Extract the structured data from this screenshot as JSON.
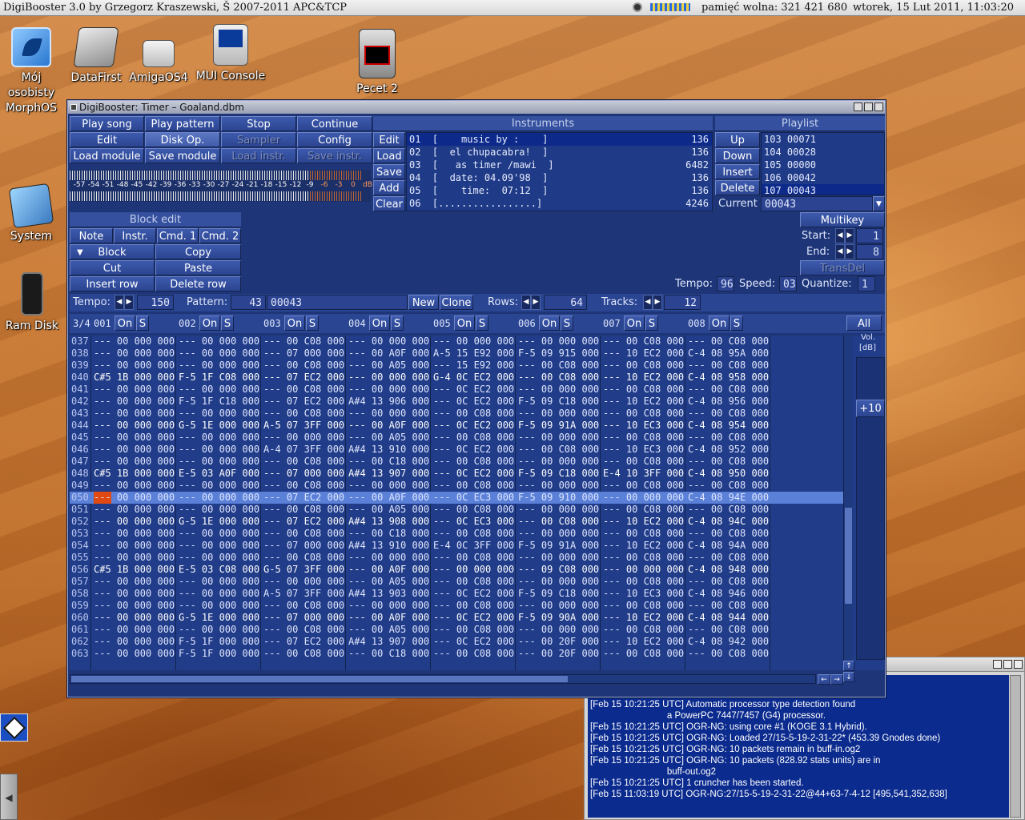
{
  "menubar": {
    "app_title": "DigiBooster 3.0 by Grzegorz Kraszewski, Š 2007-2011 APC&TCP",
    "memory": "pamięć wolna: 321 421 680",
    "clock": "wtorek, 15 Lut 2011, 11:03:20"
  },
  "desktop_icons": [
    {
      "label1": "Mój",
      "label2": "osobisty",
      "label3": "MorphOS",
      "icon": "butterfly-icon"
    },
    {
      "label1": "DataFirst",
      "icon": "harddisk-icon"
    },
    {
      "label1": "AmigaOS4",
      "icon": "amiga-boingball-icon"
    },
    {
      "label1": "MUI Console",
      "icon": "console-monitor-icon"
    },
    {
      "label1": "Pecet 2",
      "icon": "network-computer-icon"
    },
    {
      "label1": "System",
      "icon": "system-disk-icon"
    },
    {
      "label1": "Ram Disk",
      "icon": "ram-chip-icon"
    }
  ],
  "window": {
    "title": "DigiBooster: Timer – Goaland.dbm"
  },
  "transport": {
    "play_song": "Play song",
    "play_pattern": "Play pattern",
    "stop": "Stop",
    "continue": "Continue",
    "edit": "Edit",
    "disk_op": "Disk Op.",
    "sampler": "Sampler",
    "config": "Config",
    "load_module": "Load module",
    "save_module": "Save module",
    "load_instr": "Load instr.",
    "save_instr": "Save instr."
  },
  "vu_scale": [
    "-57",
    "-54",
    "-51",
    "-48",
    "-45",
    "-42",
    "-39",
    "-36",
    "-33",
    "-30",
    "-27",
    "-24",
    "-21",
    "-18",
    "-15",
    "-12",
    "-9",
    "-6",
    "-3",
    "0",
    "dB"
  ],
  "instruments": {
    "header": "Instruments",
    "buttons": {
      "edit": "Edit",
      "load": "Load",
      "save": "Save",
      "add": "Add",
      "clear": "Clear"
    },
    "rows": [
      {
        "text": "01  [    music by :    ]",
        "size": "136"
      },
      {
        "text": "02  [  el chupacabra!  ]",
        "size": "136"
      },
      {
        "text": "03  [   as timer /mawi  ]",
        "size": "6482"
      },
      {
        "text": "04  [  date: 04.09'98  ]",
        "size": "136"
      },
      {
        "text": "05  [    time:  07:12  ]",
        "size": "136"
      },
      {
        "text": "06  [.................]",
        "size": "4246"
      }
    ]
  },
  "playlist": {
    "header": "Playlist",
    "buttons": {
      "up": "Up",
      "down": "Down",
      "insert": "Insert",
      "delete": "Delete"
    },
    "rows": [
      "103 00071",
      "104 00028",
      "105 00000",
      "106 00042",
      "107 00043"
    ],
    "current_label": "Current",
    "current_value": "00043"
  },
  "block_edit": {
    "header": "Block edit",
    "note": "Note",
    "instr": "Instr.",
    "cmd1": "Cmd. 1",
    "cmd2": "Cmd. 2",
    "block": "Block",
    "copy": "Copy",
    "cut": "Cut",
    "paste": "Paste",
    "insert_row": "Insert row",
    "delete_row": "Delete row"
  },
  "multikey": {
    "header": "Multikey",
    "start_label": "Start:",
    "start_value": "1",
    "end_label": "End:",
    "end_value": "8",
    "transdel": "TransDel"
  },
  "status_line": {
    "tempo_label": "Tempo:",
    "tempo_value": "96",
    "speed_label": "Speed:",
    "speed_value": "03",
    "quantize_label": "Quantize:",
    "quantize_value": "1"
  },
  "pattern_bar": {
    "tempo_label": "Tempo:",
    "tempo_value": "150",
    "pattern_label": "Pattern:",
    "pattern_value": "43",
    "pattern_name": "00043",
    "new": "New",
    "clone": "Clone",
    "rows_label": "Rows:",
    "rows_value": "64",
    "tracks_label": "Tracks:",
    "tracks_value": "12"
  },
  "track_header": {
    "signature": "3/4",
    "tracks": [
      "001",
      "002",
      "003",
      "004",
      "005",
      "006",
      "007",
      "008"
    ],
    "on": "On",
    "s": "S",
    "all": "All",
    "vol_label": "Vol.",
    "vol_unit": "[dB]",
    "vol_value": "+10"
  },
  "pattern_rows": [
    [
      "037",
      "--- 00 000 000",
      "--- 00 000 000",
      "--- 00 C08 000",
      "--- 00 000 000",
      "--- 00 000 000",
      "--- 00 000 000",
      "--- 00 C08 000",
      "--- 00 C08 000"
    ],
    [
      "038",
      "--- 00 000 000",
      "--- 00 000 000",
      "--- 07 000 000",
      "--- 00 A0F 000",
      "A-5 15 E92 000",
      "F-5 09 915 000",
      "--- 10 EC2 000",
      "C-4 08 95A 000"
    ],
    [
      "039",
      "--- 00 000 000",
      "--- 00 000 000",
      "--- 00 C08 000",
      "--- 00 A05 000",
      "--- 15 E92 000",
      "--- 00 C08 000",
      "--- 00 C08 000",
      "--- 00 C08 000"
    ],
    [
      "040",
      "C#5 1B 000 000",
      "F-5 1F C08 000",
      "--- 07 EC2 000",
      "--- 00 000 000",
      "G-4 0C EC2 000",
      "--- 00 C08 000",
      "--- 10 EC2 000",
      "C-4 08 958 000"
    ],
    [
      "041",
      "--- 00 000 000",
      "--- 00 000 000",
      "--- 00 C08 000",
      "--- 00 000 000",
      "--- 0C EC2 000",
      "--- 00 000 000",
      "--- 00 C08 000",
      "--- 00 C08 000"
    ],
    [
      "042",
      "--- 00 000 000",
      "F-5 1F C18 000",
      "--- 07 EC2 000",
      "A#4 13 906 000",
      "--- 0C EC2 000",
      "F-5 09 C18 000",
      "--- 10 EC2 000",
      "C-4 08 956 000"
    ],
    [
      "043",
      "--- 00 000 000",
      "--- 00 000 000",
      "--- 00 C08 000",
      "--- 00 000 000",
      "--- 00 C08 000",
      "--- 00 000 000",
      "--- 00 C08 000",
      "--- 00 C08 000"
    ],
    [
      "044",
      "--- 00 000 000",
      "G-5 1E 000 000",
      "A-5 07 3FF 000",
      "--- 00 A0F 000",
      "--- 0C EC2 000",
      "F-5 09 91A 000",
      "--- 10 EC3 000",
      "C-4 08 954 000"
    ],
    [
      "045",
      "--- 00 000 000",
      "--- 00 000 000",
      "--- 00 000 000",
      "--- 00 A05 000",
      "--- 00 C08 000",
      "--- 00 000 000",
      "--- 00 C08 000",
      "--- 00 C08 000"
    ],
    [
      "046",
      "--- 00 000 000",
      "--- 00 000 000",
      "A-4 07 3FF 000",
      "A#4 13 910 000",
      "--- 0C EC2 000",
      "--- 00 C08 000",
      "--- 10 EC3 000",
      "C-4 08 952 000"
    ],
    [
      "047",
      "--- 00 000 000",
      "--- 00 000 000",
      "--- 00 C08 000",
      "--- 00 C18 000",
      "--- 00 C08 000",
      "--- 00 000 000",
      "--- 00 C08 000",
      "--- 00 C08 000"
    ],
    [
      "048",
      "C#5 1B 000 000",
      "E-5 03 A0F 000",
      "--- 07 000 000",
      "A#4 13 907 000",
      "--- 0C EC2 000",
      "F-5 09 C18 000",
      "E-4 10 3FF 000",
      "C-4 08 950 000"
    ],
    [
      "049",
      "--- 00 000 000",
      "--- 00 000 000",
      "--- 00 C08 000",
      "--- 00 000 000",
      "--- 00 C08 000",
      "--- 00 000 000",
      "--- 00 C08 000",
      "--- 00 C08 000"
    ],
    [
      "050",
      "--- 00 000 000",
      "--- 00 000 000",
      "--- 07 EC2 000",
      "--- 00 A0F 000",
      "--- 0C EC3 000",
      "F-5 09 910 000",
      "--- 00 000 000",
      "C-4 08 94E 000"
    ],
    [
      "051",
      "--- 00 000 000",
      "--- 00 000 000",
      "--- 00 C08 000",
      "--- 00 A05 000",
      "--- 00 C08 000",
      "--- 00 000 000",
      "--- 00 C08 000",
      "--- 00 C08 000"
    ],
    [
      "052",
      "--- 00 000 000",
      "G-5 1E 000 000",
      "--- 07 EC2 000",
      "A#4 13 908 000",
      "--- 0C EC3 000",
      "--- 00 C08 000",
      "--- 10 EC2 000",
      "C-4 08 94C 000"
    ],
    [
      "053",
      "--- 00 000 000",
      "--- 00 000 000",
      "--- 00 C08 000",
      "--- 00 C18 000",
      "--- 00 C08 000",
      "--- 00 000 000",
      "--- 00 C08 000",
      "--- 00 C08 000"
    ],
    [
      "054",
      "--- 00 000 000",
      "--- 00 000 000",
      "--- 07 000 000",
      "A#4 13 910 000",
      "E-4 0C 3FF 000",
      "F-5 09 91A 000",
      "--- 10 EC2 000",
      "C-4 08 94A 000"
    ],
    [
      "055",
      "--- 00 000 000",
      "--- 00 000 000",
      "--- 00 C08 000",
      "--- 00 000 000",
      "--- 00 C08 000",
      "--- 00 000 000",
      "--- 00 C08 000",
      "--- 00 C08 000"
    ],
    [
      "056",
      "C#5 1B 000 000",
      "E-5 03 C08 000",
      "G-5 07 3FF 000",
      "--- 00 A0F 000",
      "--- 00 000 000",
      "--- 09 C08 000",
      "--- 00 000 000",
      "C-4 08 948 000"
    ],
    [
      "057",
      "--- 00 000 000",
      "--- 00 000 000",
      "--- 00 000 000",
      "--- 00 A05 000",
      "--- 00 C08 000",
      "--- 00 000 000",
      "--- 00 C08 000",
      "--- 00 C08 000"
    ],
    [
      "058",
      "--- 00 000 000",
      "--- 00 000 000",
      "A-5 07 3FF 000",
      "A#4 13 903 000",
      "--- 0C EC2 000",
      "F-5 09 C18 000",
      "--- 10 EC3 000",
      "C-4 08 946 000"
    ],
    [
      "059",
      "--- 00 000 000",
      "--- 00 000 000",
      "--- 00 C08 000",
      "--- 00 000 000",
      "--- 00 C08 000",
      "--- 00 000 000",
      "--- 00 C08 000",
      "--- 00 C08 000"
    ],
    [
      "060",
      "--- 00 000 000",
      "G-5 1E 000 000",
      "--- 07 000 000",
      "--- 00 A0F 000",
      "--- 0C EC2 000",
      "F-5 09 90A 000",
      "--- 10 EC2 000",
      "C-4 08 944 000"
    ],
    [
      "061",
      "--- 00 000 000",
      "--- 00 000 000",
      "--- 00 C08 000",
      "--- 00 A05 000",
      "--- 00 C08 000",
      "--- 00 000 000",
      "--- 00 C08 000",
      "--- 00 C08 000"
    ],
    [
      "062",
      "--- 00 000 000",
      "F-5 1F 000 000",
      "--- 07 EC2 000",
      "A#4 13 907 000",
      "--- 0C EC2 000",
      "--- 00 20F 000",
      "--- 10 EC2 000",
      "C-4 08 942 000"
    ],
    [
      "063",
      "--- 00 000 000",
      "F-5 1F 000 000",
      "--- 00 C08 000",
      "--- 00 C18 000",
      "--- 00 C08 000",
      "--- 00 20F 000",
      "--- 00 C08 000",
      "--- 00 C08 000"
    ]
  ],
  "console": {
    "lines": [
      "[Feb 15 10:21:25 UTC] Automatic processor type detection found",
      "                              a PowerPC 7447/7457 (G4) processor.",
      "[Feb 15 10:21:25 UTC] OGR-NG: using core #1 (KOGE 3.1 Hybrid).",
      "[Feb 15 10:21:25 UTC] OGR-NG: Loaded 27/15-5-19-2-31-22* (453.39 Gnodes done)",
      "[Feb 15 10:21:25 UTC] OGR-NG: 10 packets remain in buff-in.og2",
      "[Feb 15 10:21:25 UTC] OGR-NG: 10 packets (828.92 stats units) are in",
      "                              buff-out.og2",
      "[Feb 15 10:21:25 UTC] 1 cruncher has been started.",
      "[Feb 15 11:03:19 UTC] OGR-NG:27/15-5-19-2-31-22@44+63-7-4-12 [495,541,352,638]"
    ]
  }
}
